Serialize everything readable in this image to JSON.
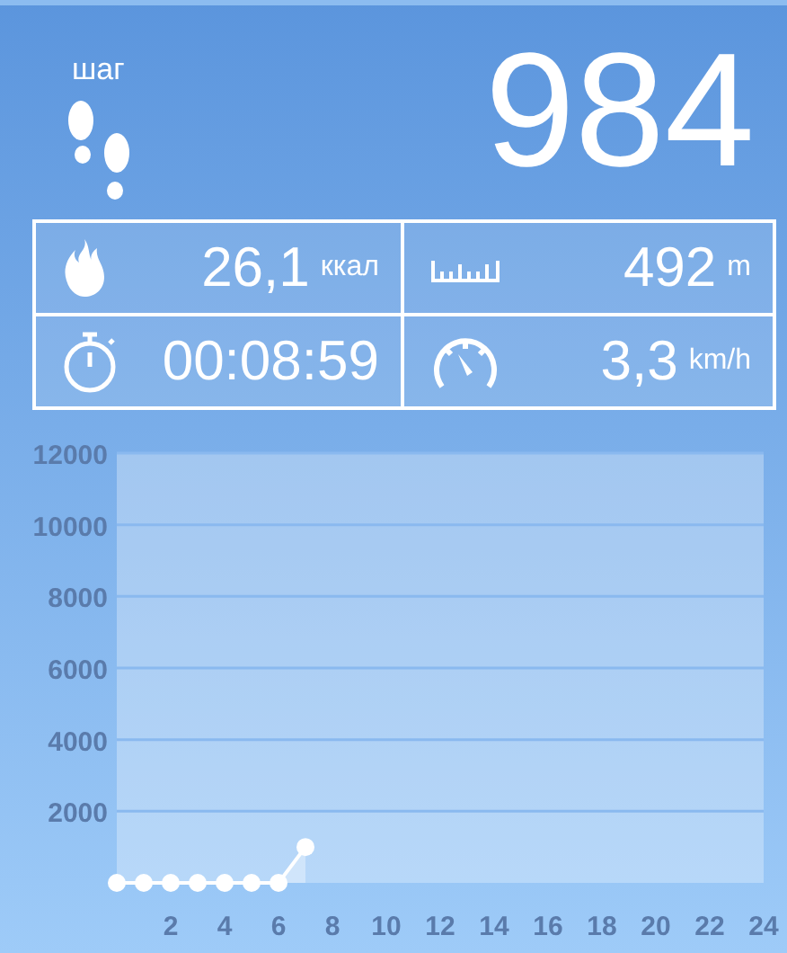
{
  "header": {
    "unit_label": "шаг",
    "steps": "984"
  },
  "stats": [
    {
      "kind": "calories",
      "value": "26,1",
      "unit": "ккал"
    },
    {
      "kind": "distance",
      "value": "492",
      "unit": "m"
    },
    {
      "kind": "time",
      "value": "00:08:59"
    },
    {
      "kind": "speed",
      "value": "3,3",
      "unit": "km/h"
    }
  ],
  "chart_data": {
    "type": "area",
    "x": [
      0,
      1,
      2,
      3,
      4,
      5,
      6,
      7
    ],
    "series": [
      {
        "color": "#ffffff",
        "values": [
          0,
          0,
          0,
          0,
          0,
          0,
          0,
          1000
        ]
      }
    ],
    "grid": true,
    "xlim": [
      0,
      24
    ],
    "ylim": [
      0,
      12000
    ],
    "xticks": [
      2,
      4,
      6,
      8,
      10,
      12,
      14,
      16,
      18,
      20,
      22,
      24
    ],
    "yticks": [
      2000,
      4000,
      6000,
      8000,
      10000,
      12000
    ]
  }
}
